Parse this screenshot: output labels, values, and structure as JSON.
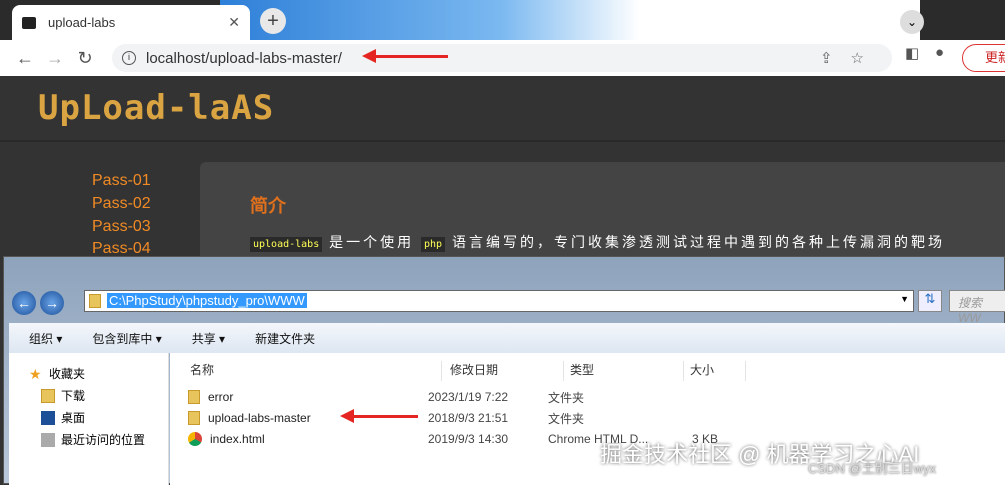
{
  "browser": {
    "tab_title": "upload-labs",
    "url": "localhost/upload-labs-master/",
    "update_label": "更新"
  },
  "site": {
    "logo": "UpLoad-laAS",
    "passes": [
      "Pass-01",
      "Pass-02",
      "Pass-03",
      "Pass-04"
    ],
    "intro_heading": "简介",
    "intro_code1": "upload-labs",
    "intro_text1": "是一个使用",
    "intro_code2": "php",
    "intro_text2": "语言编写的，专门收集渗透测试过程中遇到的各种上传漏洞的靶场"
  },
  "explorer": {
    "path": "C:\\PhpStudy\\phpstudy_pro\\WWW",
    "search_placeholder": "搜索 WW",
    "commands": [
      "组织 ▾",
      "包含到库中 ▾",
      "共享 ▾",
      "新建文件夹"
    ],
    "sidebar": [
      "收藏夹",
      "下载",
      "桌面",
      "最近访问的位置"
    ],
    "columns": [
      "名称",
      "修改日期",
      "类型",
      "大小"
    ],
    "files": [
      {
        "name": "error",
        "date": "2023/1/19 7:22",
        "type": "文件夹",
        "size": ""
      },
      {
        "name": "upload-labs-master",
        "date": "2018/9/3 21:51",
        "type": "文件夹",
        "size": ""
      },
      {
        "name": "index.html",
        "date": "2019/9/3 14:30",
        "type": "Chrome HTML D...",
        "size": "3 KB"
      }
    ]
  },
  "watermark": {
    "main": "掘金技术社区 @ 机器学习之心AI",
    "sub": "CSDN @土别三日wyx"
  }
}
